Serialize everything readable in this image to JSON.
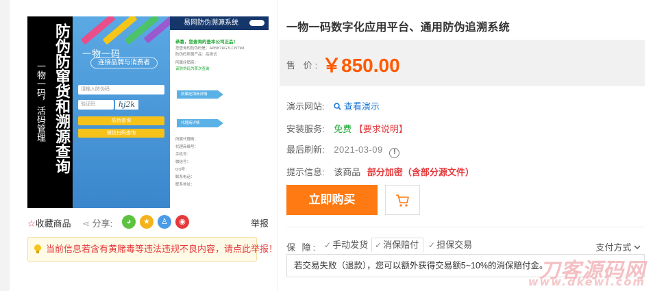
{
  "product_image": {
    "vertical_big_text": "防伪防窜货和溯源查询",
    "vertical_small_text": "一物一码，活码管理",
    "phone_title": "一物一码",
    "phone_subtitle": "连接品牌与消费者",
    "input_placeholder": "请输入防伪码",
    "captcha_placeholder": "验证码",
    "captcha_text": "hj2k",
    "button_query": "防伪查询",
    "button_scan": "微信扫码查询",
    "right_header": "易网防伪溯源系统",
    "result_lines": [
      "恭喜，您查询的是本公司正品！",
      "您查询的防伪码是：APB87RG7LCNTWI",
      "防伪码所属产品：品测试",
      "所属经销商：",
      "该防伪码为首次查询",
      "所属代理商：",
      "代理商编号：",
      "手机号：",
      "微信号：",
      "QQ号：",
      "联系电话：",
      "联系地址："
    ],
    "arrow_labels": [
      "所属经销商详情",
      "代理商详情"
    ]
  },
  "image_footer": {
    "favorite": "收藏商品",
    "share": "分享:",
    "share_icons": [
      "wechat-icon",
      "qzone-icon",
      "qq-icon",
      "weibo-icon"
    ],
    "report": "举报"
  },
  "warning": "当前信息若含有黄赌毒等违法违规不良内容，请点此举报！",
  "product": {
    "title": "一物一码数字化应用平台、通用防伪追溯系统",
    "price_label": "售 价:",
    "price": "￥850.00",
    "demo_label": "演示网站:",
    "demo_link": "查看演示",
    "install_label": "安装服务:",
    "install_free": "免费",
    "install_req": "【要求说明】",
    "refresh_label": "最后刷新:",
    "refresh_date": "2021-03-09",
    "hint_label": "提示信息:",
    "hint_text": "该商品",
    "hint_red": "部分加密（含部分源文件）"
  },
  "actions": {
    "buy": "立即购买"
  },
  "guarantee": {
    "label": "保 障:",
    "items": [
      "手动发货",
      "消保赔付",
      "担保交易"
    ],
    "pay_method": "支付方式",
    "description": "若交易失败（退款），您可以额外获得交易额5~10%的消保赔付金。"
  },
  "watermark": {
    "main": "刀客源码网",
    "url": "www.dkewl.com"
  },
  "colors": {
    "price": "#ff5a00",
    "buy_button": "#ff7a13",
    "link": "#1d7ad9",
    "free": "#18a52d",
    "warning_red": "#e4393c"
  }
}
